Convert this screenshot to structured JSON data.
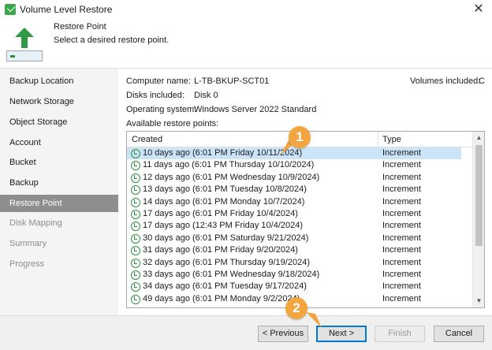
{
  "window": {
    "title": "Volume Level Restore",
    "close_label": "✕"
  },
  "header": {
    "title": "Restore Point",
    "subtitle": "Select a desired restore point."
  },
  "sidebar": {
    "items": [
      {
        "label": "Backup Location",
        "state": "normal"
      },
      {
        "label": "Network Storage",
        "state": "normal"
      },
      {
        "label": "Object Storage",
        "state": "normal"
      },
      {
        "label": "Account",
        "state": "normal"
      },
      {
        "label": "Bucket",
        "state": "normal"
      },
      {
        "label": "Backup",
        "state": "normal"
      },
      {
        "label": "Restore Point",
        "state": "active"
      },
      {
        "label": "Disk Mapping",
        "state": "disabled"
      },
      {
        "label": "Summary",
        "state": "disabled"
      },
      {
        "label": "Progress",
        "state": "disabled"
      }
    ]
  },
  "info": {
    "computer_name_label": "Computer name:",
    "computer_name": "L-TB-BKUP-SCT01",
    "volumes_included_label": "Volumes included:",
    "volumes_included": "C",
    "disks_included_label": "Disks included:",
    "disks_included": "Disk 0",
    "os_label": "Operating system:",
    "os": "Windows Server 2022 Standard",
    "restore_points_label": "Available restore points:"
  },
  "table": {
    "columns": {
      "created": "Created",
      "type": "Type"
    },
    "rows": [
      {
        "created": "10 days ago (6:01 PM Friday 10/11/2024)",
        "type": "Increment",
        "selected": true
      },
      {
        "created": "11 days ago (6:01 PM Thursday 10/10/2024)",
        "type": "Increment"
      },
      {
        "created": "12 days ago (6:01 PM Wednesday 10/9/2024)",
        "type": "Increment"
      },
      {
        "created": "13 days ago (6:01 PM Tuesday 10/8/2024)",
        "type": "Increment"
      },
      {
        "created": "14 days ago (6:01 PM Monday 10/7/2024)",
        "type": "Increment"
      },
      {
        "created": "17 days ago (6:01 PM Friday 10/4/2024)",
        "type": "Increment"
      },
      {
        "created": "17 days ago (12:43 PM Friday 10/4/2024)",
        "type": "Increment"
      },
      {
        "created": "30 days ago (6:01 PM Saturday 9/21/2024)",
        "type": "Increment"
      },
      {
        "created": "31 days ago (6:01 PM Friday 9/20/2024)",
        "type": "Increment"
      },
      {
        "created": "32 days ago (6:01 PM Thursday 9/19/2024)",
        "type": "Increment"
      },
      {
        "created": "33 days ago (6:01 PM Wednesday 9/18/2024)",
        "type": "Increment"
      },
      {
        "created": "34 days ago (6:01 PM Tuesday 9/17/2024)",
        "type": "Increment"
      },
      {
        "created": "49 days ago (6:01 PM Monday 9/2/2024)",
        "type": "Increment"
      }
    ]
  },
  "scrollbar": {
    "up_label": "▲",
    "down_label": "▼"
  },
  "buttons": {
    "previous": "< Previous",
    "next": "Next >",
    "finish": "Finish",
    "cancel": "Cancel"
  },
  "callouts": {
    "first": "1",
    "second": "2"
  },
  "colors": {
    "accent": "#0078d7",
    "selection": "#cce4f7",
    "callout": "#f2a541",
    "sidebar_active": "#8e8e8e",
    "icon_green": "#2f8f3e"
  }
}
